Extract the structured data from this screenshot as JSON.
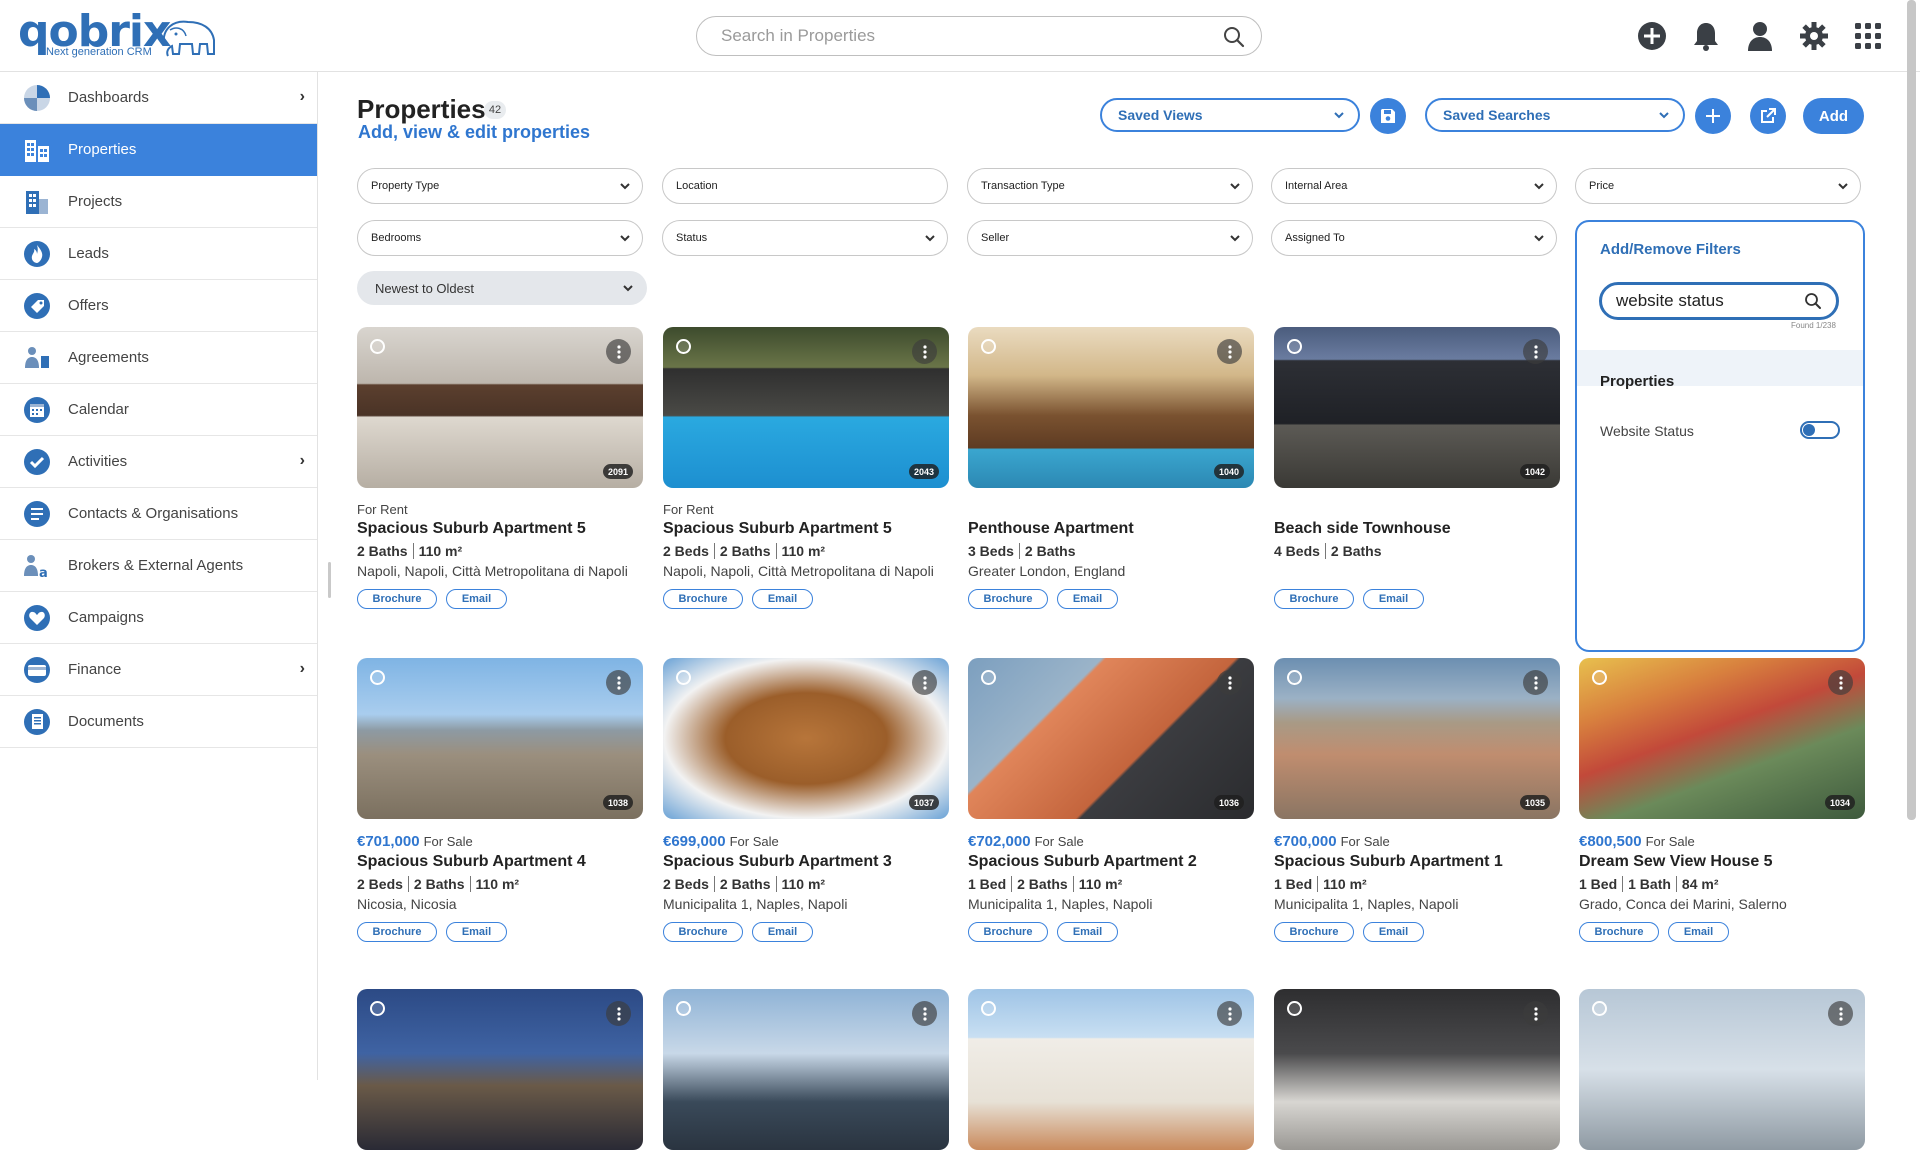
{
  "app": {
    "logo_text": "qobrix",
    "logo_tagline": "Next generation CRM"
  },
  "search": {
    "placeholder": "Search in Properties"
  },
  "topbar_icons": [
    "add-circle-icon",
    "bell-icon",
    "user-icon",
    "gear-icon",
    "apps-grid-icon"
  ],
  "sidebar": {
    "items": [
      {
        "label": "Dashboards",
        "icon": "pie-chart-icon",
        "has_children": true,
        "active": false
      },
      {
        "label": "Properties",
        "icon": "building-icon",
        "has_children": false,
        "active": true
      },
      {
        "label": "Projects",
        "icon": "city-icon",
        "has_children": false,
        "active": false
      },
      {
        "label": "Leads",
        "icon": "flame-icon",
        "has_children": false,
        "active": false
      },
      {
        "label": "Offers",
        "icon": "tag-icon",
        "has_children": false,
        "active": false
      },
      {
        "label": "Agreements",
        "icon": "handshake-icon",
        "has_children": false,
        "active": false
      },
      {
        "label": "Calendar",
        "icon": "calendar-icon",
        "has_children": false,
        "active": false
      },
      {
        "label": "Activities",
        "icon": "check-circle-icon",
        "has_children": true,
        "active": false
      },
      {
        "label": "Contacts & Organisations",
        "icon": "contacts-icon",
        "has_children": false,
        "active": false
      },
      {
        "label": "Brokers & External Agents",
        "icon": "agent-icon",
        "has_children": false,
        "active": false
      },
      {
        "label": "Campaigns",
        "icon": "heart-icon",
        "has_children": false,
        "active": false
      },
      {
        "label": "Finance",
        "icon": "finance-icon",
        "has_children": true,
        "active": false
      },
      {
        "label": "Documents",
        "icon": "document-icon",
        "has_children": false,
        "active": false
      }
    ]
  },
  "page": {
    "title": "Properties",
    "count": "42",
    "subtitle": "Add, view & edit properties",
    "saved_views_label": "Saved Views",
    "saved_searches_label": "Saved Searches",
    "add_label": "Add"
  },
  "filters": {
    "row1": [
      "Property Type",
      "Location",
      "Transaction Type",
      "Internal Area",
      "Price"
    ],
    "row2": [
      "Bedrooms",
      "Status",
      "Seller",
      "Assigned To"
    ],
    "sort": "Newest to Oldest"
  },
  "filter_panel": {
    "title": "Add/Remove Filters",
    "search_value": "website status",
    "found_text": "Found 1/238",
    "section_title": "Properties",
    "option_label": "Website Status",
    "option_enabled": false
  },
  "cards": [
    {
      "id": "2091",
      "price": "",
      "transaction": "For Rent",
      "title": "Spacious Suburb Apartment 5",
      "specs": [
        "2 Baths",
        "110 m²"
      ],
      "location": "Napoli, Napoli, Città Metropolitana di Napoli",
      "brochure": "Brochure",
      "email": "Email",
      "image": "kitchen-interior"
    },
    {
      "id": "2043",
      "price": "",
      "transaction": "For Rent",
      "title": "Spacious Suburb Apartment 5",
      "specs": [
        "2 Beds",
        "2 Baths",
        "110 m²"
      ],
      "location": "Napoli, Napoli, Città Metropolitana di Napoli",
      "brochure": "Brochure",
      "email": "Email",
      "image": "villa-pool"
    },
    {
      "id": "1040",
      "price": "",
      "transaction": "",
      "title": "Penthouse Apartment",
      "specs": [
        "3 Beds",
        "2 Baths"
      ],
      "location": "Greater London, England",
      "brochure": "Brochure",
      "email": "Email",
      "image": "pergola-pool"
    },
    {
      "id": "1042",
      "price": "",
      "transaction": "",
      "title": "Beach side Townhouse",
      "specs": [
        "4 Beds",
        "2 Baths"
      ],
      "location": "",
      "brochure": "Brochure",
      "email": "Email",
      "image": "modern-house-night"
    },
    {
      "id": "1038",
      "price": "€701,000",
      "transaction": "For Sale",
      "title": "Spacious Suburb Apartment 4",
      "specs": [
        "2 Beds",
        "2 Baths",
        "110 m²"
      ],
      "location": "Nicosia, Nicosia",
      "brochure": "Brochure",
      "email": "Email",
      "image": "city-view-volcano"
    },
    {
      "id": "1037",
      "price": "€699,000",
      "transaction": "For Sale",
      "title": "Spacious Suburb Apartment 3",
      "specs": [
        "2 Beds",
        "2 Baths",
        "110 m²"
      ],
      "location": "Municipalita 1, Naples, Napoli",
      "brochure": "Brochure",
      "email": "Email",
      "image": "building-from-below"
    },
    {
      "id": "1036",
      "price": "€702,000",
      "transaction": "For Sale",
      "title": "Spacious Suburb Apartment 2",
      "specs": [
        "1 Bed",
        "2 Baths",
        "110 m²"
      ],
      "location": "Municipalita 1, Naples, Napoli",
      "brochure": "Brochure",
      "email": "Email",
      "image": "orange-balconies"
    },
    {
      "id": "1035",
      "price": "€700,000",
      "transaction": "For Sale",
      "title": "Spacious Suburb Apartment 1",
      "specs": [
        "1 Bed",
        "110 m²"
      ],
      "location": "Municipalita 1, Naples, Napoli",
      "brochure": "Brochure",
      "email": "Email",
      "image": "dense-city"
    },
    {
      "id": "1034",
      "price": "€800,500",
      "transaction": "For Sale",
      "title": "Dream Sew View House 5",
      "specs": [
        "1 Bed",
        "1 Bath",
        "84 m²"
      ],
      "location": "Grado, Conca dei Marini, Salerno",
      "brochure": "Brochure",
      "email": "Email",
      "image": "colorful-cliff-village"
    },
    {
      "id": "",
      "image": "night-village"
    },
    {
      "id": "",
      "image": "hill-town-clouds"
    },
    {
      "id": "",
      "image": "white-house"
    },
    {
      "id": "",
      "image": "dark-kitchen"
    },
    {
      "id": "",
      "image": "street-lamp-sky"
    }
  ],
  "colors": {
    "accent": "#3b82dc",
    "brand": "#2f6fb6"
  }
}
